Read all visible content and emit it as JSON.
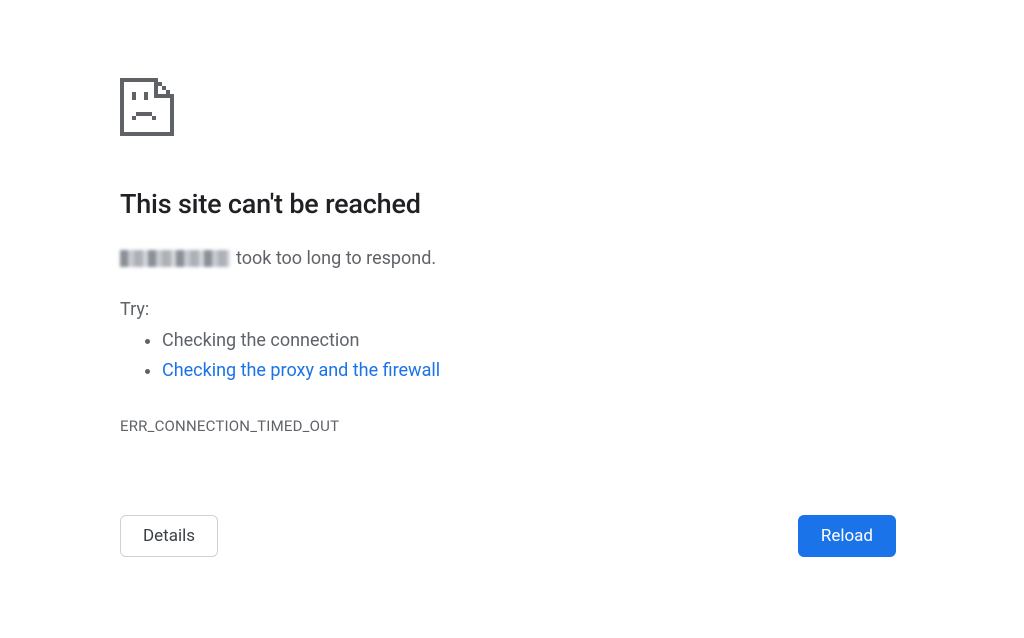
{
  "error": {
    "title": "This site can't be reached",
    "message_suffix": "took too long to respond.",
    "try_label": "Try:",
    "suggestions": [
      {
        "text": "Checking the connection",
        "link": false
      },
      {
        "text": "Checking the proxy and the firewall",
        "link": true
      }
    ],
    "error_code": "ERR_CONNECTION_TIMED_OUT"
  },
  "buttons": {
    "details_label": "Details",
    "reload_label": "Reload"
  },
  "icon_name": "sad-page-icon",
  "colors": {
    "text_primary": "#202124",
    "text_secondary": "#5f6368",
    "link": "#1a73e8",
    "button_primary_bg": "#1a73e8",
    "button_secondary_border": "#cfd1d4"
  }
}
